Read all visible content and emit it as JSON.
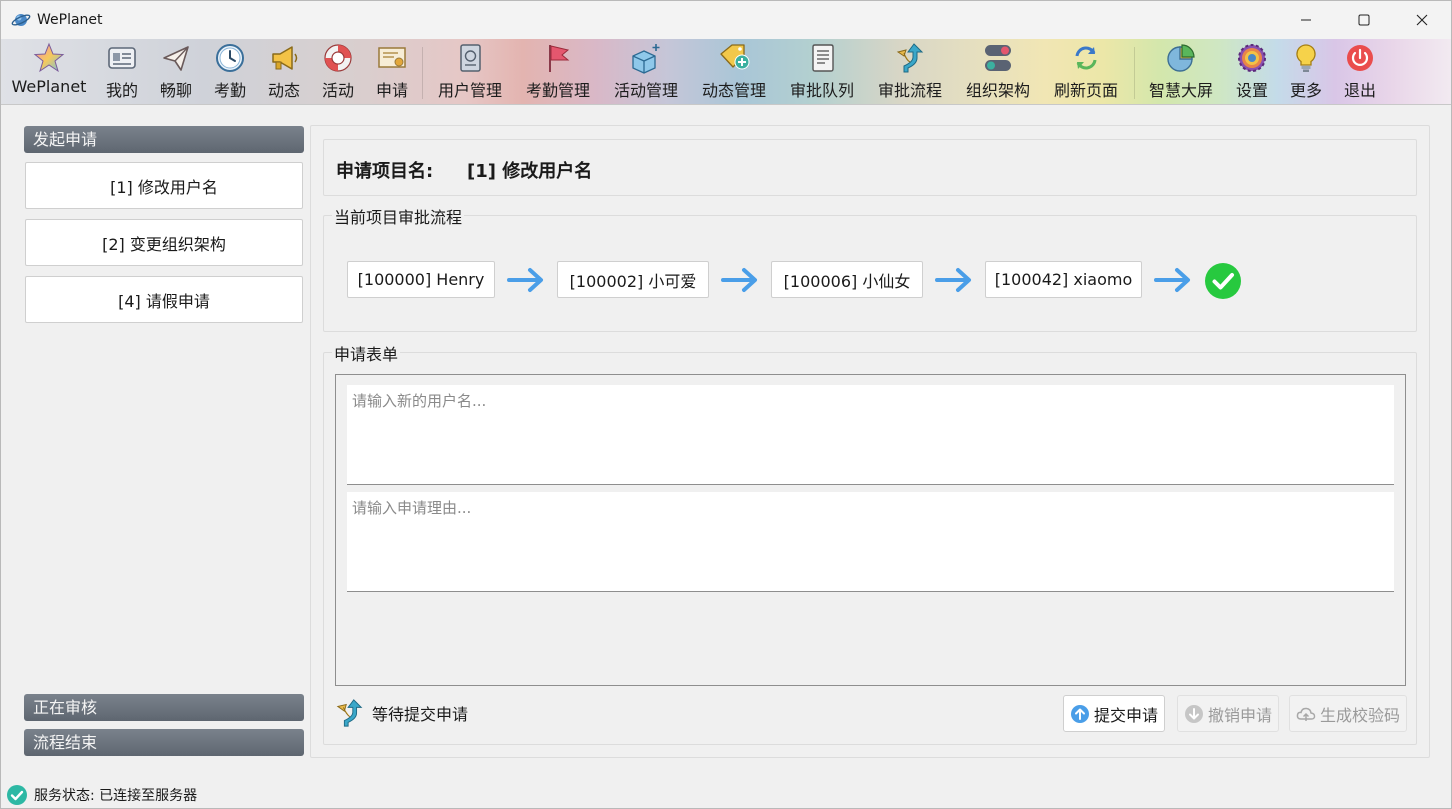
{
  "window": {
    "title": "WePlanet"
  },
  "toolbar": {
    "items": [
      {
        "label": "WePlanet",
        "icon": "star-icon"
      },
      {
        "label": "我的",
        "icon": "id-card-icon"
      },
      {
        "label": "畅聊",
        "icon": "paper-plane-icon"
      },
      {
        "label": "考勤",
        "icon": "clock-icon"
      },
      {
        "label": "动态",
        "icon": "megaphone-icon"
      },
      {
        "label": "活动",
        "icon": "lifebuoy-icon"
      },
      {
        "label": "申请",
        "icon": "certificate-icon"
      },
      {
        "label": "用户管理",
        "icon": "passport-icon"
      },
      {
        "label": "考勤管理",
        "icon": "flag-icon"
      },
      {
        "label": "活动管理",
        "icon": "cube-add-icon"
      },
      {
        "label": "动态管理",
        "icon": "tag-add-icon"
      },
      {
        "label": "审批队列",
        "icon": "scroll-icon"
      },
      {
        "label": "审批流程",
        "icon": "route-arrow-icon"
      },
      {
        "label": "组织架构",
        "icon": "toggle-icon"
      },
      {
        "label": "刷新页面",
        "icon": "refresh-icon"
      },
      {
        "label": "智慧大屏",
        "icon": "pie-chart-icon"
      },
      {
        "label": "设置",
        "icon": "gear-icon"
      },
      {
        "label": "更多",
        "icon": "lightbulb-icon"
      },
      {
        "label": "退出",
        "icon": "power-icon"
      }
    ]
  },
  "sidebar": {
    "start_header": "发起申请",
    "items": [
      {
        "label": "[1] 修改用户名"
      },
      {
        "label": "[2] 变更组织架构"
      },
      {
        "label": "[4] 请假申请"
      }
    ],
    "reviewing_header": "正在审核",
    "finished_header": "流程结束"
  },
  "main": {
    "project_label": "申请项目名:",
    "project_name": "[1] 修改用户名",
    "flow_title": "当前项目审批流程",
    "flow_nodes": [
      {
        "label": "[100000] Henry"
      },
      {
        "label": "[100002] 小可爱"
      },
      {
        "label": "[100006] 小仙女"
      },
      {
        "label": "[100042] xiaomo"
      }
    ],
    "form_title": "申请表单",
    "username_placeholder": "请输入新的用户名...",
    "reason_placeholder": "请输入申请理由...",
    "status_text": "等待提交申请",
    "submit_label": "提交申请",
    "revoke_label": "撤销申请",
    "code_label": "生成校验码"
  },
  "statusbar": {
    "text": "服务状态: 已连接至服务器"
  },
  "colors": {
    "accent_blue": "#4a9ee8",
    "success_green": "#27c93f",
    "header_gray": "#6b737d"
  }
}
